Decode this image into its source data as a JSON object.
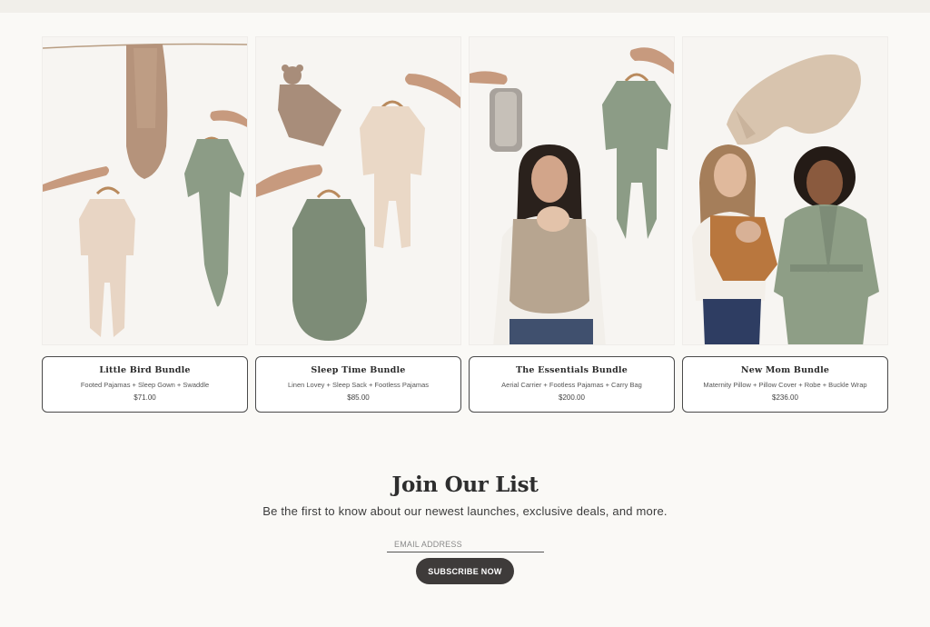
{
  "products": [
    {
      "title": "Little Bird Bundle",
      "description": "Footed Pajamas + Sleep Gown + Swaddle",
      "price": "$71.00"
    },
    {
      "title": "Sleep Time Bundle",
      "description": "Linen Lovey + Sleep Sack + Footless Pajamas",
      "price": "$85.00"
    },
    {
      "title": "The Essentials Bundle",
      "description": "Aerial Carrier + Footless Pajamas + Carry Bag",
      "price": "$200.00"
    },
    {
      "title": "New Mom Bundle",
      "description": "Maternity Pillow + Pillow Cover + Robe + Buckle Wrap",
      "price": "$236.00"
    }
  ],
  "newsletter": {
    "title": "Join Our List",
    "subtitle": "Be the first to know about our newest launches, exclusive deals, and more.",
    "email_placeholder": "EMAIL ADDRESS",
    "button_label": "SUBSCRIBE NOW"
  },
  "colors": {
    "background": "#faf9f6",
    "sage": "#8a9a84",
    "oat": "#e6d6c6",
    "taupe": "#a68e7a",
    "button": "#3e3b3a"
  }
}
